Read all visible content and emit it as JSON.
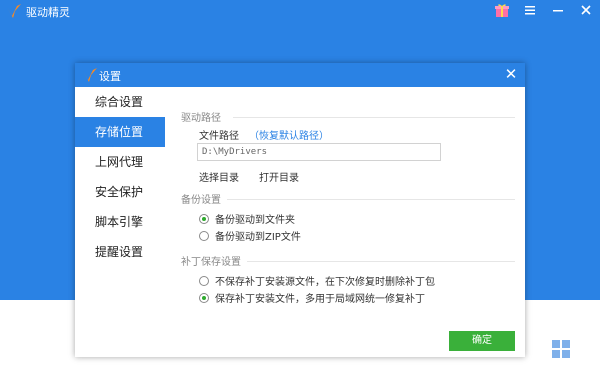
{
  "app": {
    "title": "驱动精灵",
    "icons": [
      "gift-icon",
      "menu-icon",
      "minimize-icon",
      "close-icon"
    ]
  },
  "dialog": {
    "title": "设置",
    "close_symbol": "✕",
    "sidebar": [
      {
        "label": "综合设置",
        "active": false
      },
      {
        "label": "存储位置",
        "active": true
      },
      {
        "label": "上网代理",
        "active": false
      },
      {
        "label": "安全保护",
        "active": false
      },
      {
        "label": "脚本引擎",
        "active": false
      },
      {
        "label": "提醒设置",
        "active": false
      }
    ],
    "driver_path": {
      "section": "驱动路径",
      "file_path_label": "文件路径",
      "restore_link": "（恢复默认路径）",
      "path_value": "D:\\MyDrivers",
      "choose_dir": "选择目录",
      "open_dir": "打开目录"
    },
    "backup": {
      "section": "备份设置",
      "options": [
        {
          "label": "备份驱动到文件夹",
          "checked": true
        },
        {
          "label": "备份驱动到ZIP文件",
          "checked": false
        }
      ]
    },
    "patch": {
      "section": "补丁保存设置",
      "options": [
        {
          "label": "不保存补丁安装源文件，在下次修复时删除补丁包",
          "checked": false
        },
        {
          "label": "保存补丁安装文件，多用于局域网统一修复补丁",
          "checked": true
        }
      ]
    },
    "ok_label": "确定"
  },
  "colors": {
    "accent": "#2a82e4",
    "ok_button": "#3ab03a",
    "radio_checked": "#2faa2f"
  }
}
